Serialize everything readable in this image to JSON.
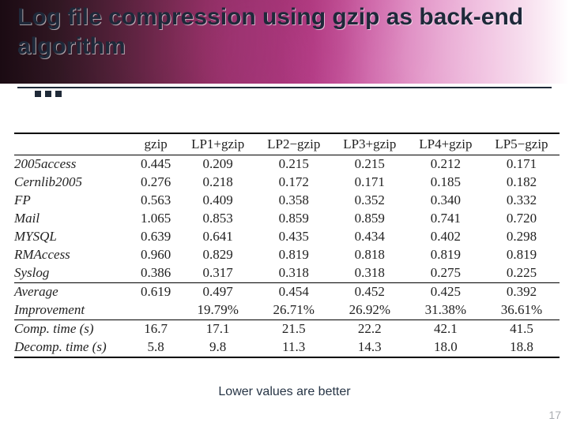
{
  "title": "Log file compression using gzip as back-end algorithm",
  "caption": "Lower values are better",
  "page_number": "17",
  "table": {
    "headers": [
      "",
      "gzip",
      "LP1+gzip",
      "LP2−gzip",
      "LP3+gzip",
      "LP4+gzip",
      "LP5−gzip"
    ],
    "body": [
      [
        "2005access",
        "0.445",
        "0.209",
        "0.215",
        "0.215",
        "0.212",
        "0.171"
      ],
      [
        "Cernlib2005",
        "0.276",
        "0.218",
        "0.172",
        "0.171",
        "0.185",
        "0.182"
      ],
      [
        "FP",
        "0.563",
        "0.409",
        "0.358",
        "0.352",
        "0.340",
        "0.332"
      ],
      [
        "Mail",
        "1.065",
        "0.853",
        "0.859",
        "0.859",
        "0.741",
        "0.720"
      ],
      [
        "MYSQL",
        "0.639",
        "0.641",
        "0.435",
        "0.434",
        "0.402",
        "0.298"
      ],
      [
        "RMAccess",
        "0.960",
        "0.829",
        "0.819",
        "0.818",
        "0.819",
        "0.819"
      ],
      [
        "Syslog",
        "0.386",
        "0.317",
        "0.318",
        "0.318",
        "0.275",
        "0.225"
      ]
    ],
    "summary": [
      [
        "Average",
        "0.619",
        "0.497",
        "0.454",
        "0.452",
        "0.425",
        "0.392"
      ],
      [
        "Improvement",
        "",
        "19.79%",
        "26.71%",
        "26.92%",
        "31.38%",
        "36.61%"
      ]
    ],
    "timing": [
      [
        "Comp. time (s)",
        "16.7",
        "17.1",
        "21.5",
        "22.2",
        "42.1",
        "41.5"
      ],
      [
        "Decomp. time (s)",
        "5.8",
        "9.8",
        "11.3",
        "14.3",
        "18.0",
        "18.8"
      ]
    ]
  },
  "chart_data": {
    "type": "table",
    "title": "Log file compression using gzip as back-end algorithm",
    "columns": [
      "dataset",
      "gzip",
      "LP1+gzip",
      "LP2−gzip",
      "LP3+gzip",
      "LP4+gzip",
      "LP5−gzip"
    ],
    "rows": [
      {
        "dataset": "2005access",
        "gzip": 0.445,
        "LP1+gzip": 0.209,
        "LP2−gzip": 0.215,
        "LP3+gzip": 0.215,
        "LP4+gzip": 0.212,
        "LP5−gzip": 0.171
      },
      {
        "dataset": "Cernlib2005",
        "gzip": 0.276,
        "LP1+gzip": 0.218,
        "LP2−gzip": 0.172,
        "LP3+gzip": 0.171,
        "LP4+gzip": 0.185,
        "LP5−gzip": 0.182
      },
      {
        "dataset": "FP",
        "gzip": 0.563,
        "LP1+gzip": 0.409,
        "LP2−gzip": 0.358,
        "LP3+gzip": 0.352,
        "LP4+gzip": 0.34,
        "LP5−gzip": 0.332
      },
      {
        "dataset": "Mail",
        "gzip": 1.065,
        "LP1+gzip": 0.853,
        "LP2−gzip": 0.859,
        "LP3+gzip": 0.859,
        "LP4+gzip": 0.741,
        "LP5−gzip": 0.72
      },
      {
        "dataset": "MYSQL",
        "gzip": 0.639,
        "LP1+gzip": 0.641,
        "LP2−gzip": 0.435,
        "LP3+gzip": 0.434,
        "LP4+gzip": 0.402,
        "LP5−gzip": 0.298
      },
      {
        "dataset": "RMAccess",
        "gzip": 0.96,
        "LP1+gzip": 0.829,
        "LP2−gzip": 0.819,
        "LP3+gzip": 0.818,
        "LP4+gzip": 0.819,
        "LP5−gzip": 0.819
      },
      {
        "dataset": "Syslog",
        "gzip": 0.386,
        "LP1+gzip": 0.317,
        "LP2−gzip": 0.318,
        "LP3+gzip": 0.318,
        "LP4+gzip": 0.275,
        "LP5−gzip": 0.225
      }
    ],
    "average": {
      "gzip": 0.619,
      "LP1+gzip": 0.497,
      "LP2−gzip": 0.454,
      "LP3+gzip": 0.452,
      "LP4+gzip": 0.425,
      "LP5−gzip": 0.392
    },
    "improvement_pct": {
      "LP1+gzip": 19.79,
      "LP2−gzip": 26.71,
      "LP3+gzip": 26.92,
      "LP4+gzip": 31.38,
      "LP5−gzip": 36.61
    },
    "comp_time_s": {
      "gzip": 16.7,
      "LP1+gzip": 17.1,
      "LP2−gzip": 21.5,
      "LP3+gzip": 22.2,
      "LP4+gzip": 42.1,
      "LP5−gzip": 41.5
    },
    "decomp_time_s": {
      "gzip": 5.8,
      "LP1+gzip": 9.8,
      "LP2−gzip": 11.3,
      "LP3+gzip": 14.3,
      "LP4+gzip": 18.0,
      "LP5−gzip": 18.8
    },
    "note": "Lower values are better"
  }
}
